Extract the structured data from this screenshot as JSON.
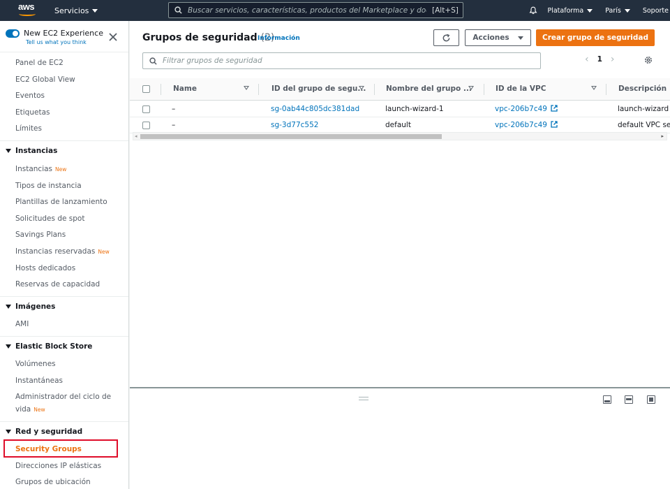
{
  "topbar": {
    "logo_text": "aws",
    "services_label": "Servicios",
    "search_placeholder": "Buscar servicios, características, productos del Marketplace y documentos",
    "search_shortcut": "[Alt+S]",
    "region_label": "Plataforma",
    "location_label": "París",
    "support_label": "Soporte"
  },
  "sidebar": {
    "experience_title": "New EC2 Experience",
    "experience_sub": "Tell us what you think",
    "top_links": [
      "Panel de EC2",
      "EC2 Global View",
      "Eventos",
      "Etiquetas",
      "Límites"
    ],
    "sections": [
      {
        "title": "Instancias",
        "items": [
          {
            "label": "Instancias",
            "badge": "New"
          },
          {
            "label": "Tipos de instancia",
            "badge": ""
          },
          {
            "label": "Plantillas de lanzamiento",
            "badge": ""
          },
          {
            "label": "Solicitudes de spot",
            "badge": ""
          },
          {
            "label": "Savings Plans",
            "badge": ""
          },
          {
            "label": "Instancias reservadas",
            "badge": "New"
          },
          {
            "label": "Hosts dedicados",
            "badge": ""
          },
          {
            "label": "Reservas de capacidad",
            "badge": ""
          }
        ]
      },
      {
        "title": "Imágenes",
        "items": [
          {
            "label": "AMI",
            "badge": ""
          }
        ]
      },
      {
        "title": "Elastic Block Store",
        "items": [
          {
            "label": "Volúmenes",
            "badge": ""
          },
          {
            "label": "Instantáneas",
            "badge": ""
          },
          {
            "label": "Administrador del ciclo de",
            "label2": "vida",
            "badge": "New"
          }
        ]
      },
      {
        "title": "Red y seguridad",
        "items": [
          {
            "label": "Security Groups",
            "badge": "",
            "active": true
          },
          {
            "label": "Direcciones IP elásticas",
            "badge": ""
          },
          {
            "label": "Grupos de ubicación",
            "badge": ""
          }
        ]
      }
    ]
  },
  "main": {
    "title": "Grupos de seguridad",
    "count": "(2)",
    "info_link": "Información",
    "actions_label": "Acciones",
    "create_label": "Crear grupo de seguridad",
    "filter_placeholder": "Filtrar grupos de seguridad",
    "page_number": "1",
    "columns": [
      "Name",
      "ID del grupo de segu...",
      "Nombre del grupo ...",
      "ID de la VPC",
      "Descripción"
    ],
    "rows": [
      {
        "name": "–",
        "group_id": "sg-0ab44c805dc381dad",
        "group_name": "launch-wizard-1",
        "vpc_id": "vpc-206b7c49",
        "description": "launch-wizard"
      },
      {
        "name": "–",
        "group_id": "sg-3d77c552",
        "group_name": "default",
        "vpc_id": "vpc-206b7c49",
        "description": "default VPC se"
      }
    ]
  },
  "colors": {
    "topbar_bg": "#232f3e",
    "accent_orange": "#ec7211",
    "link_blue": "#0073bb",
    "highlight_red": "#df0d2a"
  }
}
